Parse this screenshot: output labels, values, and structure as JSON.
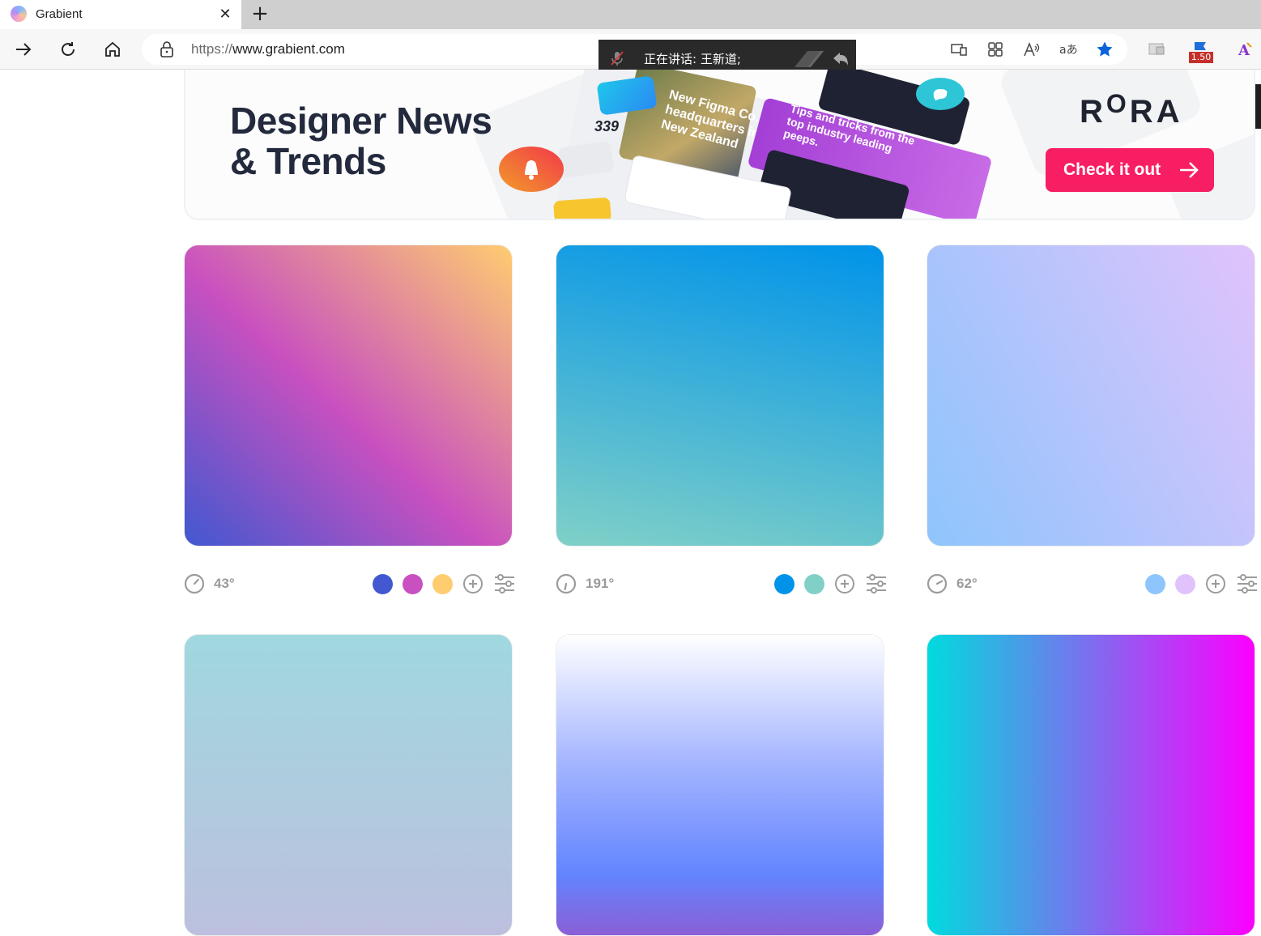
{
  "browser": {
    "tab_title": "Grabient",
    "url_prefix": "https://",
    "url_host": "www.grabient.com",
    "zoom_badge": "1.50",
    "speaking_overlay": "正在讲话: 王新道;"
  },
  "banner": {
    "title_line1": "Designer News",
    "title_line2": "& Trends",
    "logo_left": "R",
    "logo_o": "O",
    "logo_right": "RA",
    "cta_label": "Check it out",
    "mock_headline_1": "New Figma Co. headquarters in New Zealand",
    "mock_headline_2": "Tips and tricks from the top industry leading peeps.",
    "mock_count": "339"
  },
  "gradients": [
    {
      "angle": "43°",
      "colors": [
        "#4158D0",
        "#C850C0",
        "#FFCC70"
      ]
    },
    {
      "angle": "191°",
      "colors": [
        "#0093E9",
        "#80D0C7"
      ]
    },
    {
      "angle": "62°",
      "colors": [
        "#8EC5FC",
        "#E0C3FC"
      ]
    },
    {
      "angle": "",
      "colors": [
        "#a0d8df",
        "#bcc0de"
      ]
    },
    {
      "angle": "",
      "colors": [
        "#ffffff",
        "#6284FF",
        "#8a5fd6"
      ]
    },
    {
      "angle": "",
      "colors": [
        "#00dbde",
        "#fc00ff"
      ]
    }
  ],
  "colors": {
    "cta": "#f71e63",
    "angle_text": "#9b9b9b"
  }
}
